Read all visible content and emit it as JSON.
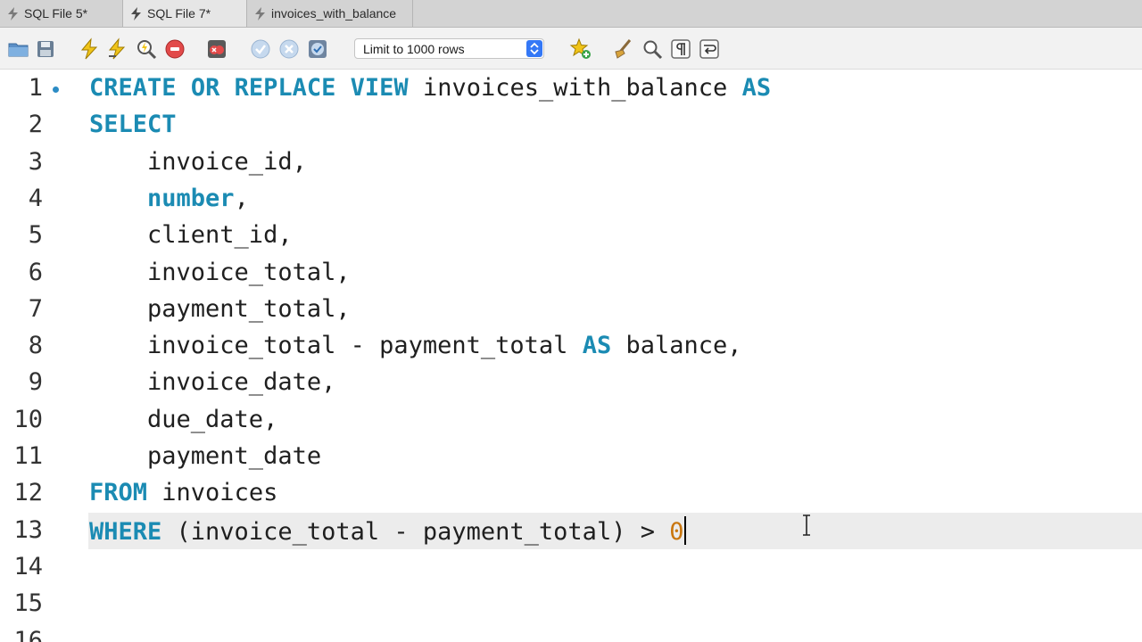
{
  "tabs": [
    {
      "label": "SQL File 5*",
      "active": false
    },
    {
      "label": "SQL File 7*",
      "active": true
    },
    {
      "label": "invoices_with_balance",
      "active": false
    }
  ],
  "toolbar": {
    "icons": [
      "open-file-icon",
      "save-icon",
      "execute-icon",
      "execute-current-icon",
      "explain-icon",
      "stop-icon",
      "toggle-error-icon",
      "commit-icon",
      "rollback-icon",
      "autocommit-icon",
      "beautify-favorite-icon",
      "beautify-icon",
      "find-icon",
      "invisible-chars-icon",
      "wrap-icon"
    ],
    "limit": {
      "value": "Limit to 1000 rows",
      "options": [
        "Limit to 1000 rows"
      ]
    }
  },
  "editor": {
    "accent": "#1b8bb3",
    "number_color": "#c9760e",
    "current_line": 13,
    "lines": [
      {
        "n": "1",
        "text": "CREATE OR REPLACE VIEW invoices_with_balance AS"
      },
      {
        "n": "2",
        "text": "SELECT"
      },
      {
        "n": "3",
        "text": "    invoice_id,"
      },
      {
        "n": "4",
        "text": "    number,"
      },
      {
        "n": "5",
        "text": "    client_id,"
      },
      {
        "n": "6",
        "text": "    invoice_total,"
      },
      {
        "n": "7",
        "text": "    payment_total,"
      },
      {
        "n": "8",
        "text": "    invoice_total - payment_total AS balance,"
      },
      {
        "n": "9",
        "text": "    invoice_date,"
      },
      {
        "n": "10",
        "text": "    due_date,"
      },
      {
        "n": "11",
        "text": "    payment_date"
      },
      {
        "n": "12",
        "text": "FROM invoices"
      },
      {
        "n": "13",
        "text": "WHERE (invoice_total - payment_total) > 0"
      },
      {
        "n": "14",
        "text": ""
      },
      {
        "n": "15",
        "text": ""
      },
      {
        "n": "16",
        "text": ""
      }
    ]
  }
}
